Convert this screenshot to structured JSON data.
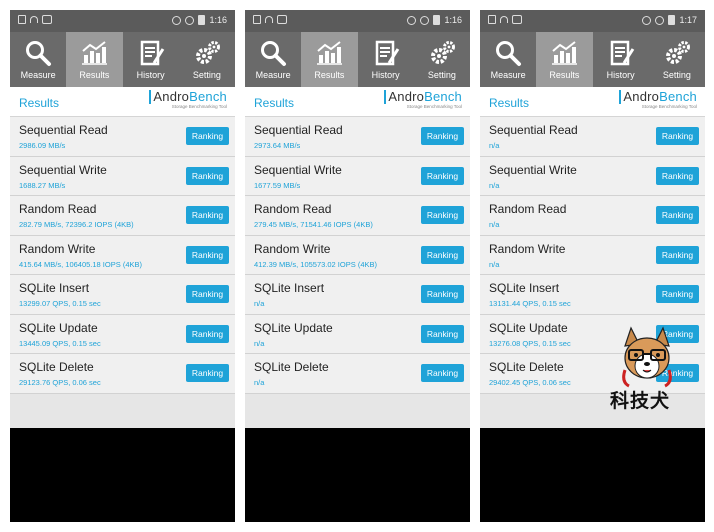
{
  "accent_color": "#1fa3d8",
  "tab_labels": [
    "Measure",
    "Results",
    "History",
    "Setting"
  ],
  "results_title": "Results",
  "logo": {
    "brand_plain": "Andro",
    "brand_accent": "Bench",
    "tagline": "Storage Benchmarking Tool"
  },
  "ranking_label": "Ranking",
  "phones": [
    {
      "status_time": "1:16",
      "rows": [
        {
          "label": "Sequential Read",
          "value": "2986.09 MB/s"
        },
        {
          "label": "Sequential Write",
          "value": "1688.27 MB/s"
        },
        {
          "label": "Random Read",
          "value": "282.79 MB/s, 72396.2 IOPS (4KB)"
        },
        {
          "label": "Random Write",
          "value": "415.64 MB/s, 106405.18 IOPS (4KB)"
        },
        {
          "label": "SQLite Insert",
          "value": "13299.07 QPS, 0.15 sec"
        },
        {
          "label": "SQLite Update",
          "value": "13445.09 QPS, 0.15 sec"
        },
        {
          "label": "SQLite Delete",
          "value": "29123.76 QPS, 0.06 sec"
        }
      ]
    },
    {
      "status_time": "1:16",
      "rows": [
        {
          "label": "Sequential Read",
          "value": "2973.64 MB/s"
        },
        {
          "label": "Sequential Write",
          "value": "1677.59 MB/s"
        },
        {
          "label": "Random Read",
          "value": "279.45 MB/s, 71541.46 IOPS (4KB)"
        },
        {
          "label": "Random Write",
          "value": "412.39 MB/s, 105573.02 IOPS (4KB)"
        },
        {
          "label": "SQLite Insert",
          "value": "n/a"
        },
        {
          "label": "SQLite Update",
          "value": "n/a"
        },
        {
          "label": "SQLite Delete",
          "value": "n/a"
        }
      ]
    },
    {
      "status_time": "1:17",
      "rows": [
        {
          "label": "Sequential Read",
          "value": "n/a"
        },
        {
          "label": "Sequential Write",
          "value": "n/a"
        },
        {
          "label": "Random Read",
          "value": "n/a"
        },
        {
          "label": "Random Write",
          "value": "n/a"
        },
        {
          "label": "SQLite Insert",
          "value": "13131.44 QPS, 0.15 sec"
        },
        {
          "label": "SQLite Update",
          "value": "13276.08 QPS, 0.15 sec"
        },
        {
          "label": "SQLite Delete",
          "value": "29402.45 QPS, 0.06 sec"
        }
      ]
    }
  ],
  "watermark_text": "科技犬"
}
